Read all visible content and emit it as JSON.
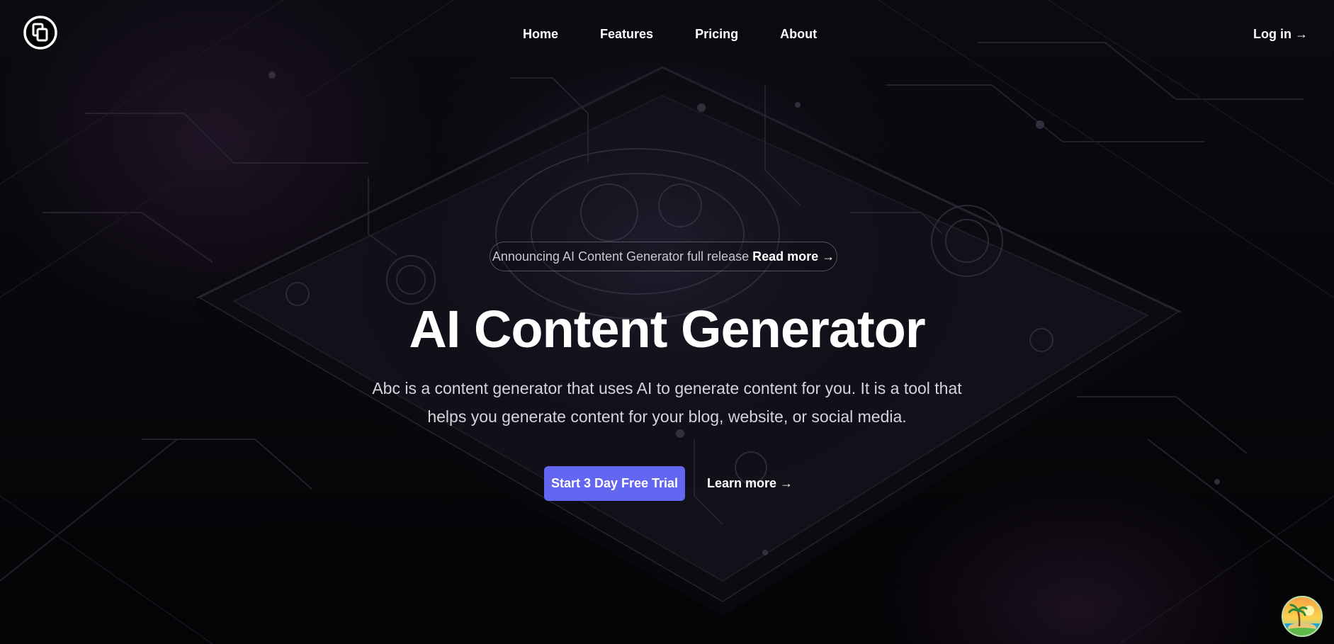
{
  "nav": {
    "logo_icon": "copy-squares-icon",
    "links": [
      {
        "label": "Home"
      },
      {
        "label": "Features"
      },
      {
        "label": "Pricing"
      },
      {
        "label": "About"
      }
    ],
    "login_label": "Log in →"
  },
  "hero": {
    "announcement": {
      "text": "Announcing AI Content Generator full release",
      "link_label": "Read more →"
    },
    "title": "AI Content Generator",
    "subtitle": "Abc is a content generator that uses AI to generate content for you. It is a tool that helps you generate content for your blog, website, or social media.",
    "primary_cta_label": "Start 3 Day Free Trial",
    "secondary_cta_label": "Learn more →"
  },
  "widget": {
    "icon": "palm-island-avatar-icon"
  },
  "colors": {
    "background": "#050407",
    "accent": "#6366f1",
    "text": "#ffffff",
    "muted_text": "#d6d3dc"
  }
}
